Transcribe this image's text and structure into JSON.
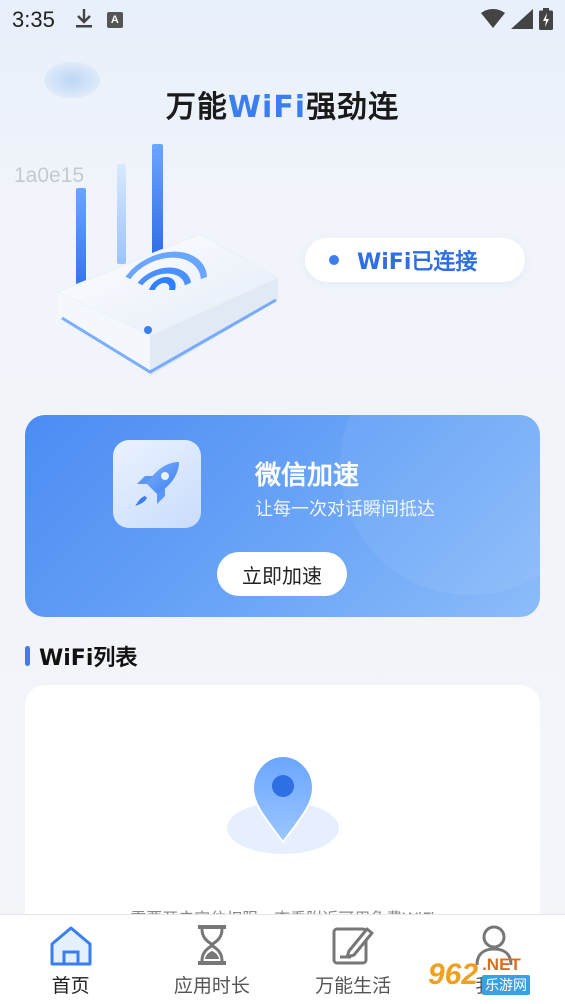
{
  "status_bar": {
    "time": "3:35",
    "left_icons": [
      "download-icon",
      "a-badge-icon"
    ],
    "a_badge_letter": "A",
    "right_icons": [
      "wifi-signal-icon",
      "cell-signal-icon",
      "battery-icon"
    ]
  },
  "header": {
    "title_prefix": "万能",
    "title_accent": "WiFi",
    "title_suffix": "强劲连",
    "device_id": "1a0e15"
  },
  "connection": {
    "status_label": "WiFi已连接"
  },
  "accelerate_card": {
    "title": "微信加速",
    "subtitle": "让每一次对话瞬间抵达",
    "button_label": "立即加速",
    "icon": "rocket-icon"
  },
  "wifi_list": {
    "section_title": "WiFi列表",
    "hint": "需要开启定位权限，查看附近可用免费WiFi",
    "icon": "location-pin-icon"
  },
  "bottom_nav": {
    "items": [
      {
        "label": "首页",
        "icon": "home-icon",
        "active": true
      },
      {
        "label": "应用时长",
        "icon": "hourglass-icon",
        "active": false
      },
      {
        "label": "万能生活",
        "icon": "edit-note-icon",
        "active": false
      },
      {
        "label": "我的",
        "icon": "user-icon",
        "active": false
      }
    ]
  },
  "watermark": {
    "main": "962",
    "net": ".NET",
    "cn": "乐游网"
  },
  "colors": {
    "accent": "#3a7ef0",
    "card_gradient_start": "#4c8cf3",
    "card_gradient_end": "#8cbcf9"
  }
}
